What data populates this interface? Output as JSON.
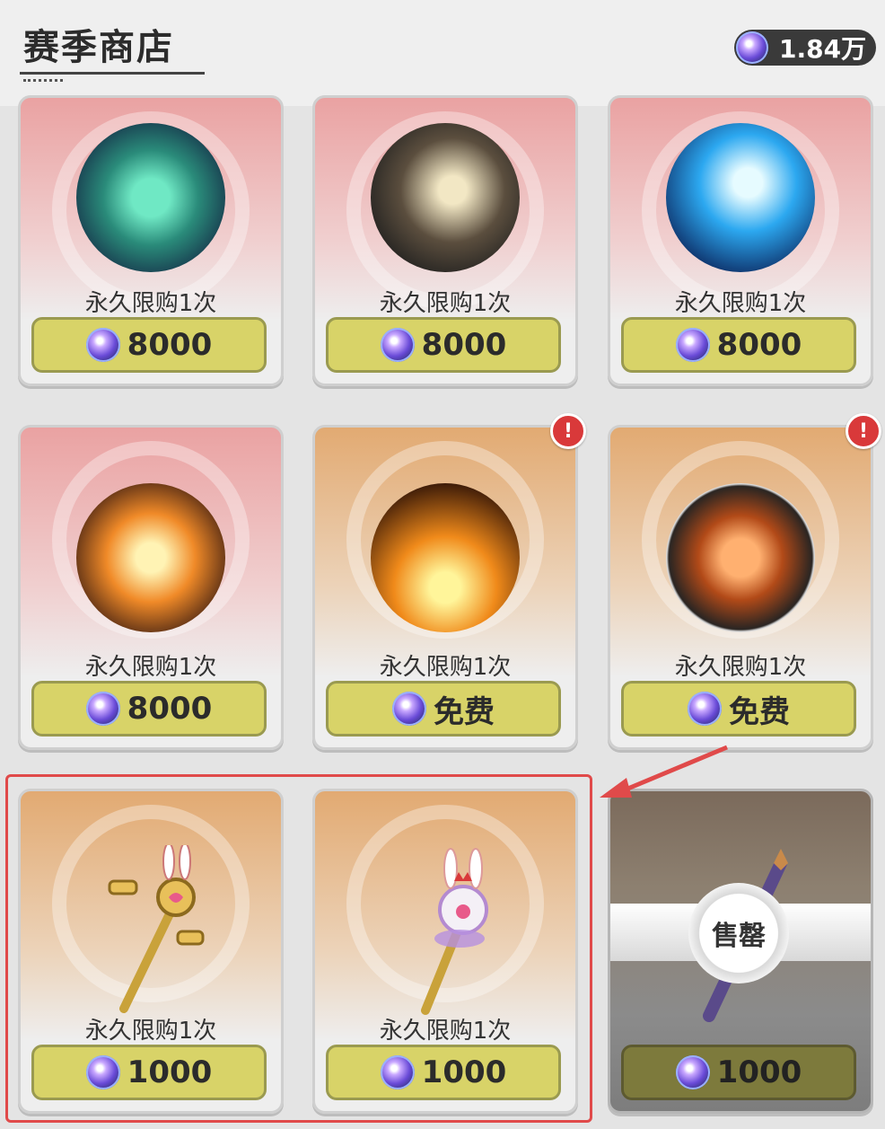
{
  "header": {
    "title": "赛季商店",
    "currency_amount": "1.84万",
    "currency_icon": "season-coin-icon"
  },
  "items": [
    {
      "name": "dragon-storm-skill",
      "limit": "永久限购1次",
      "price": "8000",
      "theme": "pink",
      "alert": false
    },
    {
      "name": "beast-claw-skill",
      "limit": "永久限购1次",
      "price": "8000",
      "theme": "pink",
      "alert": false
    },
    {
      "name": "ice-dragon-skill",
      "limit": "永久限购1次",
      "price": "8000",
      "theme": "pink",
      "alert": false
    },
    {
      "name": "phoenix-skill",
      "limit": "永久限购1次",
      "price": "8000",
      "theme": "pink",
      "alert": false
    },
    {
      "name": "rock-pet-skill",
      "limit": "永久限购1次",
      "price": "免费",
      "theme": "orange",
      "alert": true
    },
    {
      "name": "rock-pet-frame",
      "limit": "永久限购1次",
      "price": "免费",
      "theme": "orange",
      "alert": true
    },
    {
      "name": "bunny-key-staff",
      "limit": "永久限购1次",
      "price": "1000",
      "theme": "orange",
      "alert": false
    },
    {
      "name": "bunny-crown-staff",
      "limit": "永久限购1次",
      "price": "1000",
      "theme": "orange",
      "alert": false
    },
    {
      "name": "star-staff",
      "limit": "",
      "price": "1000",
      "theme": "soldout",
      "status": "售罄",
      "alert": false
    }
  ],
  "alert_mark": "!",
  "colors": {
    "price_button": "#d8d368",
    "highlight_border": "#e04a4a",
    "alert_badge": "#d9393a"
  }
}
